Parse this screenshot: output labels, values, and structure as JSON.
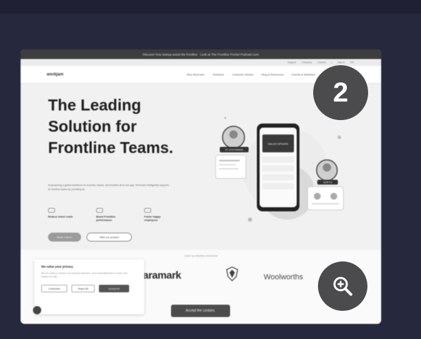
{
  "screenshot": {
    "announcement": "Discover how startup assist the frontline · Look at The Frontline Pocket Podcast Live!",
    "utility_links": [
      "Support",
      "Company",
      "Careers",
      "|",
      "Sign in",
      "EN"
    ],
    "logo": "workjam",
    "nav_links": [
      "Why WorkJam",
      "Solutions",
      "Customer Stories",
      "Blog & Resources",
      "Events & Webinars"
    ],
    "hero": {
      "title": "The Leading Solution for Frontline Teams.",
      "subtitle": "Empowering a global workforce for success, teams, and frontline all in one app. WorkJam intelligently supports its frontline teams by providing an"
    },
    "features": [
      {
        "label": "Reduce travel costs"
      },
      {
        "label": "Boost Frontline performance"
      },
      {
        "label": "Foster happy employees"
      }
    ],
    "cta_primary": "Book a demo",
    "cta_secondary": "Take our product",
    "logos_heading": "Used by industry worldwide",
    "customer_logos": {
      "aramark": "aramark",
      "woolworths": "Woolworths"
    },
    "cookie": {
      "title": "We value your privacy",
      "body": "We use cookies to enhance your browsing experience, serve personalised ads or content, and analyse our traffic.",
      "buttons": [
        "Customise",
        "Reject All",
        "Accept All"
      ]
    },
    "accept_tooltip": "Accept the cookies.",
    "art_labels": {
      "phone_header": "SALES UPDATE",
      "tag_left": "ST. EXCHANGE",
      "tag_right": "SHIFTS"
    }
  },
  "step_badge": "2",
  "colors": {
    "background": "#26283d",
    "overlay_circle": "#4b4b4d"
  },
  "icons": {
    "zoom": "zoom-in-icon"
  }
}
